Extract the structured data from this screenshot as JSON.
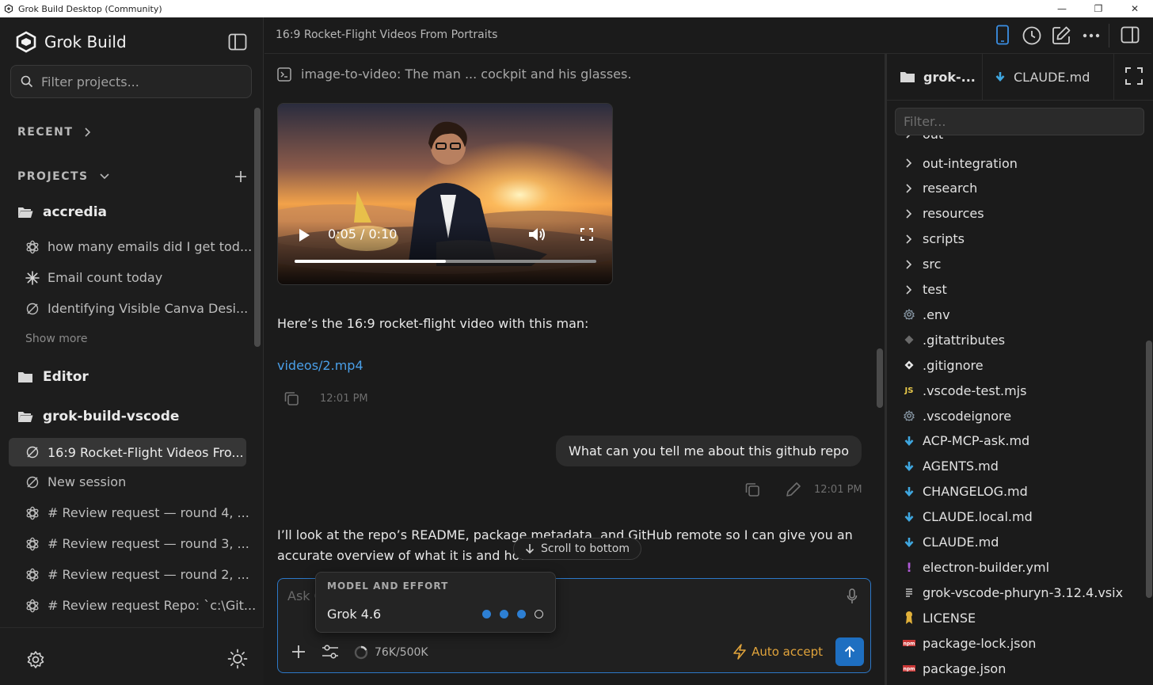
{
  "window": {
    "title": "Grok Build Desktop (Community)"
  },
  "sidebar": {
    "brand": "Grok Build",
    "filter_placeholder": "Filter projects...",
    "recent_label": "RECENT",
    "projects_label": "PROJECTS",
    "projects": [
      {
        "name": "accredia"
      },
      {
        "name": "Editor"
      },
      {
        "name": "grok-build-vscode"
      }
    ],
    "accredia_sessions": [
      "how many emails did I get tod...",
      "Email count today",
      "Identifying Visible Canva Desi..."
    ],
    "show_more": "Show more",
    "vscode_sessions": [
      "16:9 Rocket-Flight Videos Fro...",
      "New session",
      "# Review request — round 4, ...",
      "# Review request — round 3, ...",
      "# Review request — round 2, ...",
      "# Review request Repo: `c:\\Git..."
    ]
  },
  "header": {
    "title": "16:9 Rocket-Flight Videos From Portraits"
  },
  "chat": {
    "tool_call": "image-to-video: The man ... cockpit and his glasses.",
    "video": {
      "time": "0:05 / 0:10",
      "progress": 0.5
    },
    "assistant_text_1": "Here’s the 16:9 rocket-flight video with this man:",
    "video_link": "videos/2.mp4",
    "time_1": "12:01 PM",
    "user_message": "What can you tell me about this github repo",
    "time_2": "12:01 PM",
    "assistant_text_2a": "I’ll look at the repo’s README, package metadata, and GitHub remote so I can give you an",
    "assistant_text_2b": "accurate overview of what it is and how",
    "scroll_to_bottom": "Scroll to bottom"
  },
  "composer": {
    "placeholder": "Ask G",
    "context": "76K/500K",
    "auto_accept": "Auto accept"
  },
  "model_popup": {
    "header": "MODEL AND EFFORT",
    "model": "Grok 4.6",
    "effort_level": 3,
    "effort_max": 4
  },
  "file_panel": {
    "tab_folder": "grok-...",
    "tab_file": "CLAUDE.md",
    "filter_placeholder": "Filter...",
    "partial_top": "out",
    "items": [
      {
        "name": "out-integration",
        "type": "folder"
      },
      {
        "name": "research",
        "type": "folder"
      },
      {
        "name": "resources",
        "type": "folder"
      },
      {
        "name": "scripts",
        "type": "folder"
      },
      {
        "name": "src",
        "type": "folder"
      },
      {
        "name": "test",
        "type": "folder"
      },
      {
        "name": ".env",
        "type": "gear"
      },
      {
        "name": ".gitattributes",
        "type": "git"
      },
      {
        "name": ".gitignore",
        "type": "git-white"
      },
      {
        "name": ".vscode-test.mjs",
        "type": "js"
      },
      {
        "name": ".vscodeignore",
        "type": "gear"
      },
      {
        "name": "ACP-MCP-ask.md",
        "type": "md"
      },
      {
        "name": "AGENTS.md",
        "type": "md"
      },
      {
        "name": "CHANGELOG.md",
        "type": "md"
      },
      {
        "name": "CLAUDE.local.md",
        "type": "md"
      },
      {
        "name": "CLAUDE.md",
        "type": "md"
      },
      {
        "name": "electron-builder.yml",
        "type": "yml"
      },
      {
        "name": "grok-vscode-phuryn-3.12.4.vsix",
        "type": "lines"
      },
      {
        "name": "LICENSE",
        "type": "license"
      },
      {
        "name": "package-lock.json",
        "type": "npm"
      },
      {
        "name": "package.json",
        "type": "npm"
      }
    ]
  },
  "colors": {
    "accent": "#1e6fc1",
    "link": "#4a9fe8",
    "auto_accept": "#e0a33b"
  },
  "icons": [
    "grok-logo-icon",
    "sidebar-toggle-icon",
    "search-icon",
    "chevron-right-icon",
    "chevron-down-icon",
    "plus-icon",
    "folder-open-icon",
    "folder-icon",
    "openai-icon",
    "sparkle-icon",
    "session-icon",
    "gear-icon",
    "sun-icon",
    "mobile-icon",
    "history-icon",
    "edit-icon",
    "more-icon",
    "panel-icon",
    "terminal-icon",
    "play-icon",
    "volume-icon",
    "fullscreen-icon",
    "copy-icon",
    "pencil-icon",
    "arrow-down-icon",
    "mic-icon",
    "sliders-icon",
    "bolt-icon",
    "arrow-up-icon",
    "expand-icon"
  ]
}
